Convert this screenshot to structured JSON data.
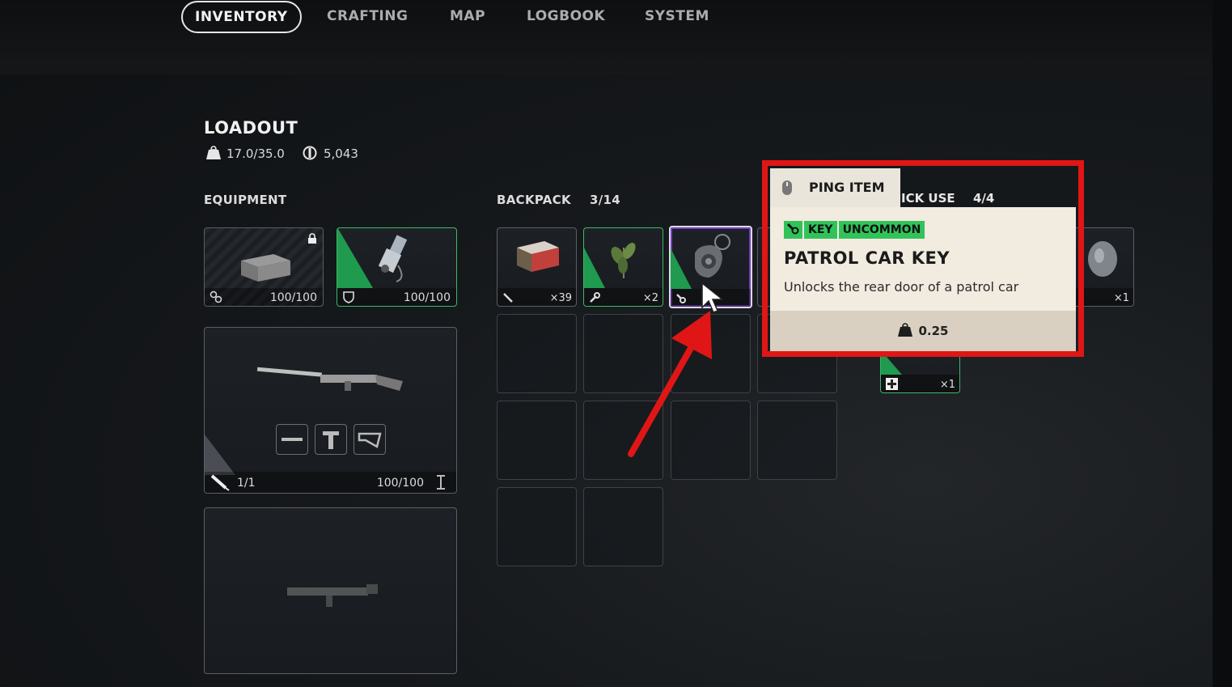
{
  "tabs": [
    {
      "label": "INVENTORY",
      "active": true
    },
    {
      "label": "CRAFTING"
    },
    {
      "label": "MAP"
    },
    {
      "label": "LOGBOOK"
    },
    {
      "label": "SYSTEM"
    }
  ],
  "loadout": {
    "title": "LOADOUT",
    "weight": "17.0/35.0",
    "currency": "5,043"
  },
  "equipment": {
    "label": "EQUIPMENT",
    "augment_durability": "100/100",
    "shield_durability": "100/100",
    "weapon": {
      "ammo": "1/1",
      "durability": "100/100"
    }
  },
  "backpack": {
    "label": "BACKPACK",
    "count": "3/14",
    "items": [
      {
        "icon": "wrench-icon",
        "qty": "×39"
      },
      {
        "icon": "wrench-icon",
        "qty": "×2"
      },
      {
        "icon": "key-icon",
        "qty": ""
      }
    ]
  },
  "quick_use": {
    "label_partial": "ICK USE",
    "count": "4/4",
    "visible_qty_1": "×1",
    "visible_qty_2": "×1"
  },
  "tooltip": {
    "ping_label": "PING ITEM",
    "tags": [
      "KEY",
      "UNCOMMON"
    ],
    "title": "PATROL CAR KEY",
    "description": "Unlocks the rear door of a patrol car",
    "weight": "0.25"
  },
  "colors": {
    "accent_green": "#31c35a",
    "highlight_red": "#e01616",
    "tooltip_bg": "#f1ebe0"
  }
}
